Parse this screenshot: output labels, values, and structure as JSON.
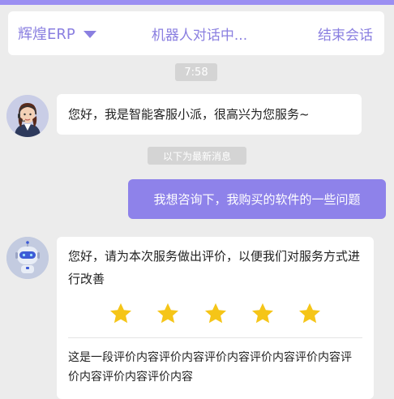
{
  "header": {
    "brand": "辉煌ERP",
    "status": "机器人对话中...",
    "end_label": "结束会话"
  },
  "chat": {
    "time": "7:58",
    "greeting": "您好，我是智能客服小派，很高兴为您服务~",
    "divider": "以下为最新消息",
    "user_message": "我想咨询下，我购买的软件的一些问题",
    "rating_prompt": "您好，请为本次服务做出评价，以便我们对服务方式进行改善",
    "rating": 5,
    "rating_max": 5,
    "comment": "这是一段评价内容评价内容评价内容评价内容评价内容评价内容评价内容评价内容"
  },
  "colors": {
    "accent": "#8e82ea",
    "star": "#f5c518",
    "background": "#ececec"
  }
}
